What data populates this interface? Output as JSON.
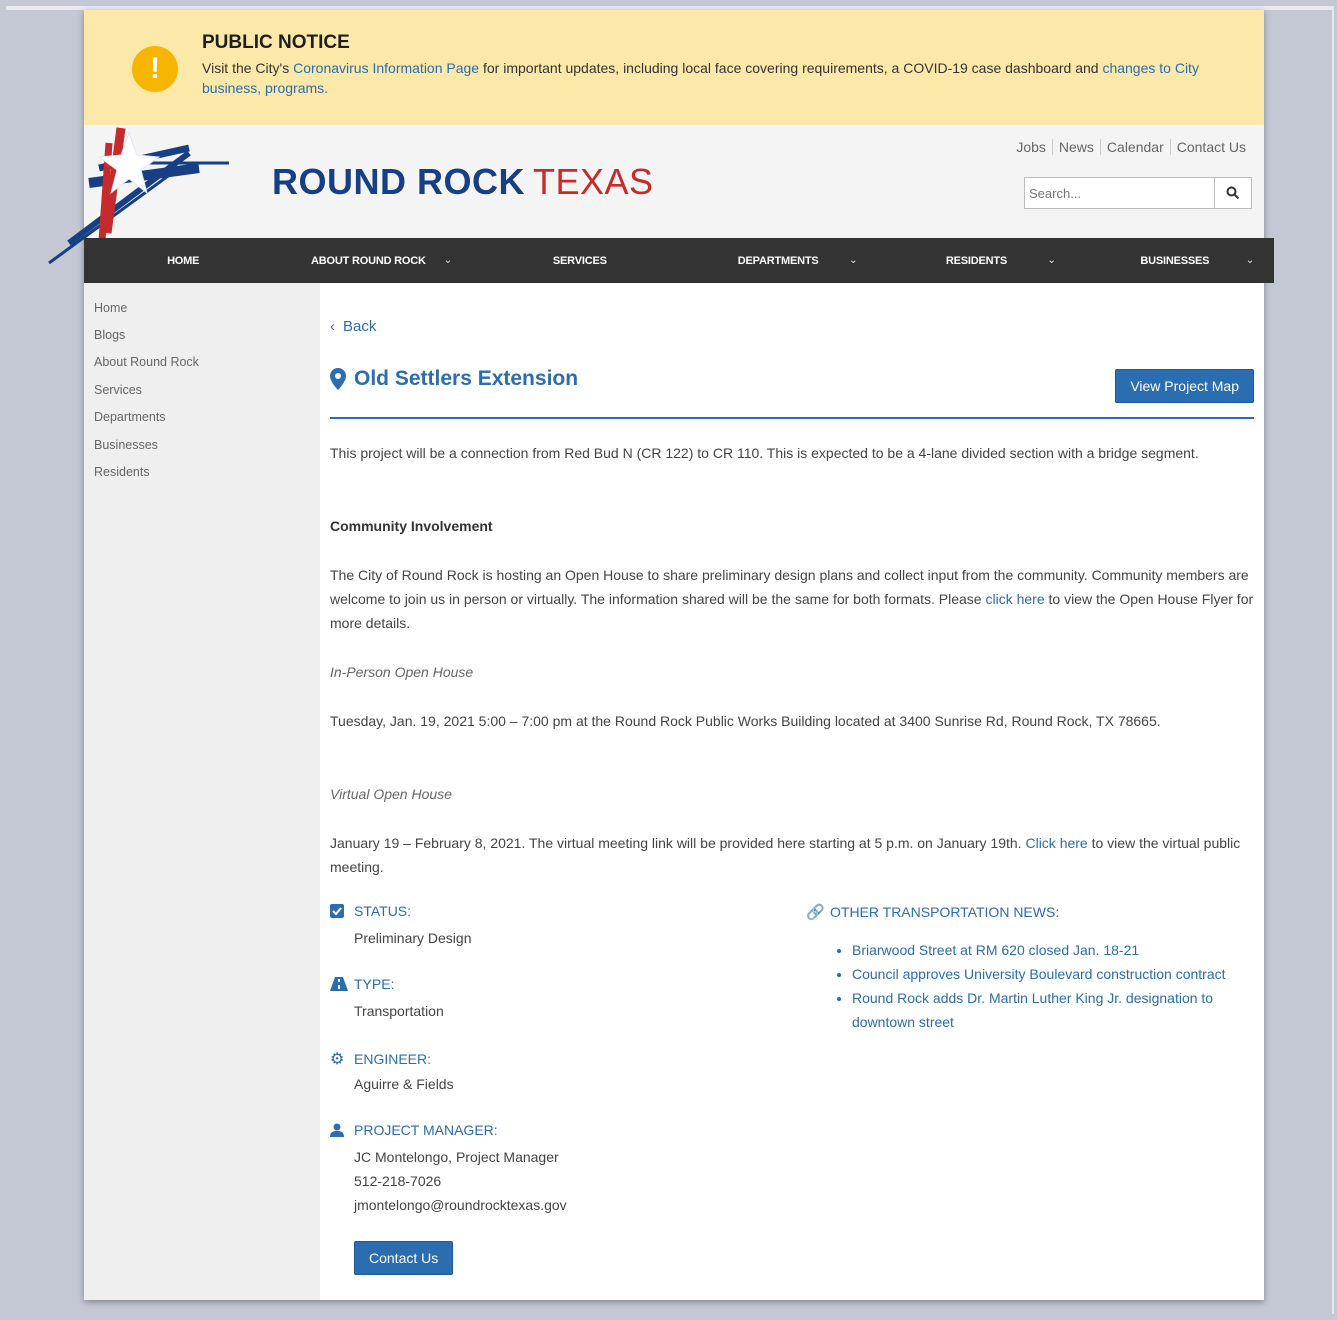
{
  "notice": {
    "title": "PUBLIC NOTICE",
    "text_before": "Visit the City's ",
    "link1": "Coronavirus Information Page",
    "text_mid": " for important updates, including local face covering requirements, a COVID-19 case dashboard and ",
    "link2": "changes to City business, programs.",
    "icon": "exclamation-icon"
  },
  "header": {
    "title_round_rock": "ROUND ROCK",
    "title_texas": "TEXAS",
    "toplinks": [
      "Jobs",
      "News",
      "Calendar",
      "Contact Us"
    ],
    "search_placeholder": "Search..."
  },
  "nav": {
    "items": [
      {
        "label": "HOME"
      },
      {
        "label": "ABOUT ROUND ROCK"
      },
      {
        "label": "SERVICES"
      },
      {
        "label": "DEPARTMENTS"
      },
      {
        "label": "RESIDENTS"
      },
      {
        "label": "BUSINESSES"
      }
    ],
    "chevron": "⌄"
  },
  "sidebar": {
    "items": [
      "Home",
      "Blogs",
      "About Round Rock",
      "Services",
      "Departments",
      "Businesses",
      "Residents"
    ]
  },
  "main": {
    "back": "Back",
    "title": "Old Settlers Extension",
    "map_button": "View Project Map",
    "description": "This project will be a connection from Red Bud N (CR 122) to CR 110. This is expected to be a 4-lane divided section with a bridge segment.",
    "community_heading": "Community Involvement",
    "community_text_before": "The City of Round Rock is hosting an Open House to share preliminary design plans and collect input from the community. Community members are welcome to join us in person or virtually. The information shared will be the same for both formats. Please ",
    "community_link": "click here",
    "community_text_after": " to view the Open House Flyer for more details.",
    "inperson_heading": "In-Person Open House",
    "inperson_text": "Tuesday, Jan. 19, 2021 5:00 – 7:00 pm at the Round Rock Public Works Building located at 3400 Sunrise Rd, Round Rock, TX 78665.",
    "virtual_heading": "Virtual Open House",
    "virtual_text_before": "January 19 – February 8, 2021. The virtual meeting link will be provided here starting at 5 p.m. on January 19th. ",
    "virtual_link": "Click here",
    "virtual_text_after": " to view the virtual public meeting.",
    "status_label": "STATUS:",
    "status_value": "Preliminary Design",
    "type_label": "TYPE:",
    "type_value": "Transportation",
    "engineer_label": "ENGINEER:",
    "engineer_value": "Aguirre & Fields",
    "pm_label": "PROJECT MANAGER:",
    "pm_name": "JC Montelongo, Project Manager",
    "pm_phone": "512-218-7026",
    "pm_email": "jmontelongo@roundrocktexas.gov",
    "contact_button": "Contact Us",
    "news_label": "OTHER TRANSPORTATION NEWS:",
    "news": [
      "Briarwood Street at RM 620 closed Jan. 18-21",
      "Council approves University Boulevard construction contract",
      "Round Rock adds Dr. Martin Luther King Jr. designation to downtown street"
    ]
  },
  "colors": {
    "brand_blue": "#2a6db0",
    "navy": "#173f84",
    "red": "#c62a2a",
    "notice_bg": "#fce8a9",
    "nav_bg": "#333333"
  }
}
